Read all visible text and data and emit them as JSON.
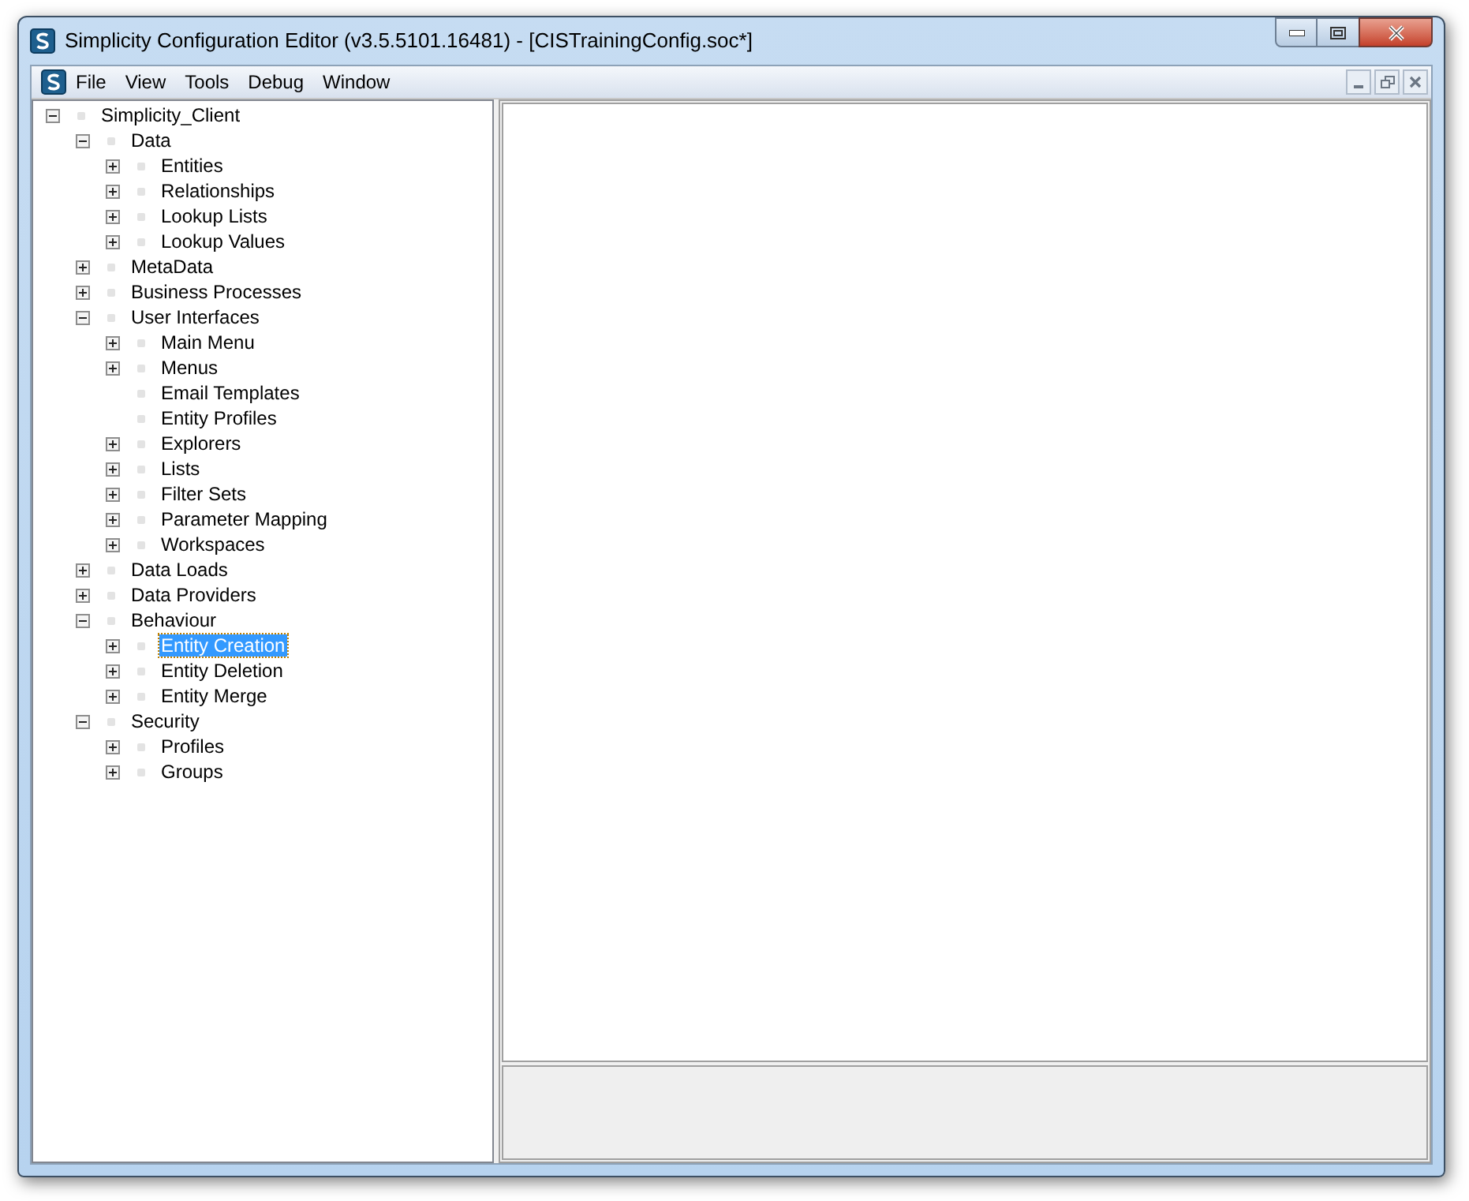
{
  "window": {
    "title": "Simplicity Configuration Editor (v3.5.5101.16481) - [CISTrainingConfig.soc*]"
  },
  "menu": [
    "File",
    "View",
    "Tools",
    "Debug",
    "Window"
  ],
  "tree": [
    {
      "label": "Simplicity_Client",
      "kind": "folder",
      "expanded": true,
      "selected": false,
      "children": [
        {
          "label": "Data",
          "kind": "folder",
          "expanded": true,
          "selected": false,
          "children": [
            {
              "label": "Entities",
              "kind": "folder",
              "expanded": false,
              "selected": false
            },
            {
              "label": "Relationships",
              "kind": "folder",
              "expanded": false,
              "selected": false
            },
            {
              "label": "Lookup Lists",
              "kind": "folder",
              "expanded": false,
              "selected": false
            },
            {
              "label": "Lookup Values",
              "kind": "folder",
              "expanded": false,
              "selected": false
            }
          ]
        },
        {
          "label": "MetaData",
          "kind": "folder",
          "expanded": false,
          "selected": false
        },
        {
          "label": "Business Processes",
          "kind": "folder",
          "expanded": false,
          "selected": false
        },
        {
          "label": "User Interfaces",
          "kind": "folder",
          "expanded": true,
          "selected": false,
          "children": [
            {
              "label": "Main Menu",
              "kind": "folder",
              "expanded": false,
              "selected": false
            },
            {
              "label": "Menus",
              "kind": "folder",
              "expanded": false,
              "selected": false
            },
            {
              "label": "Email Templates",
              "kind": "leaf",
              "selected": false
            },
            {
              "label": "Entity Profiles",
              "kind": "leaf",
              "selected": false
            },
            {
              "label": "Explorers",
              "kind": "folder",
              "expanded": false,
              "selected": false
            },
            {
              "label": "Lists",
              "kind": "folder",
              "expanded": false,
              "selected": false
            },
            {
              "label": "Filter Sets",
              "kind": "folder",
              "expanded": false,
              "selected": false
            },
            {
              "label": "Parameter Mapping",
              "kind": "folder",
              "expanded": false,
              "selected": false
            },
            {
              "label": "Workspaces",
              "kind": "folder",
              "expanded": false,
              "selected": false
            }
          ]
        },
        {
          "label": "Data Loads",
          "kind": "folder",
          "expanded": false,
          "selected": false
        },
        {
          "label": "Data Providers",
          "kind": "folder",
          "expanded": false,
          "selected": false
        },
        {
          "label": "Behaviour",
          "kind": "folder",
          "expanded": true,
          "selected": false,
          "children": [
            {
              "label": "Entity Creation",
              "kind": "folder",
              "expanded": false,
              "selected": true
            },
            {
              "label": "Entity Deletion",
              "kind": "folder",
              "expanded": false,
              "selected": false
            },
            {
              "label": "Entity Merge",
              "kind": "folder",
              "expanded": false,
              "selected": false
            }
          ]
        },
        {
          "label": "Security",
          "kind": "folder",
          "expanded": true,
          "selected": false,
          "children": [
            {
              "label": "Profiles",
              "kind": "folder",
              "expanded": false,
              "selected": false
            },
            {
              "label": "Groups",
              "kind": "folder",
              "expanded": false,
              "selected": false
            }
          ]
        }
      ]
    }
  ]
}
